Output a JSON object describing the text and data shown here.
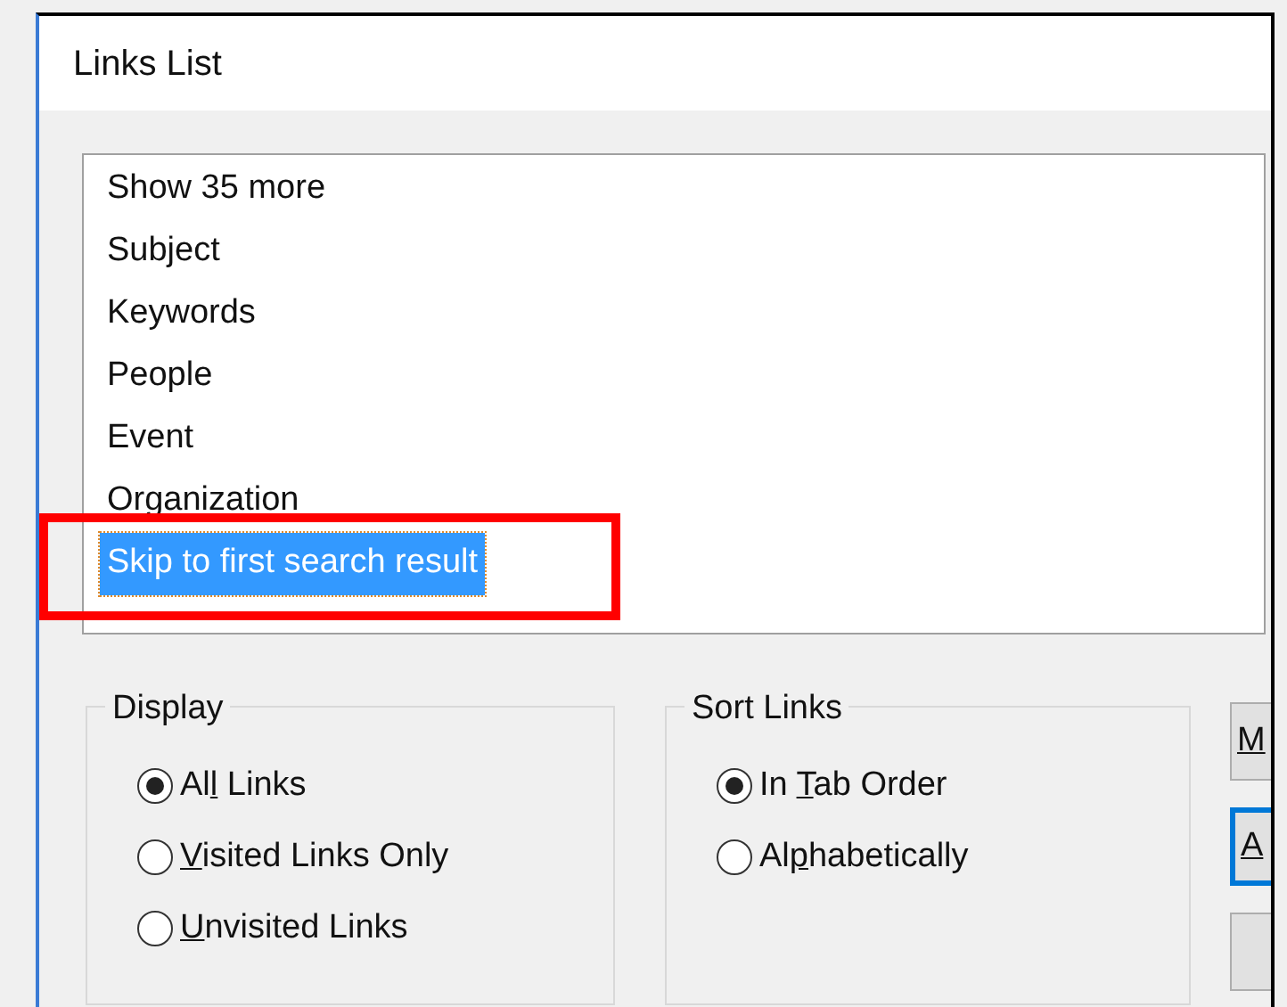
{
  "window": {
    "title": "Links List"
  },
  "links": [
    {
      "label": "Show 35 more",
      "selected": false,
      "annotated": false
    },
    {
      "label": "Subject",
      "selected": false,
      "annotated": false
    },
    {
      "label": "Keywords",
      "selected": false,
      "annotated": false
    },
    {
      "label": "People",
      "selected": false,
      "annotated": false
    },
    {
      "label": "Event",
      "selected": false,
      "annotated": false
    },
    {
      "label": "Organization",
      "selected": false,
      "annotated": false
    },
    {
      "label": "Skip to first search result",
      "selected": true,
      "annotated": true
    }
  ],
  "display": {
    "title": "Display",
    "options": [
      {
        "before": "Al",
        "key": "l",
        "after": " Links",
        "selected": true
      },
      {
        "key": "V",
        "after": "isited Links Only",
        "selected": false
      },
      {
        "key": "U",
        "after": "nvisited Links",
        "selected": false
      }
    ]
  },
  "sort_links": {
    "title": "Sort Links",
    "options": [
      {
        "before": "In ",
        "key": "T",
        "after": "ab Order",
        "selected": true
      },
      {
        "before": "Al",
        "key": "p",
        "after": "habetically",
        "selected": false
      }
    ]
  },
  "buttons": [
    {
      "key": "M",
      "focused": false
    },
    {
      "key": "A",
      "focused": true
    },
    {
      "focused": false
    }
  ]
}
